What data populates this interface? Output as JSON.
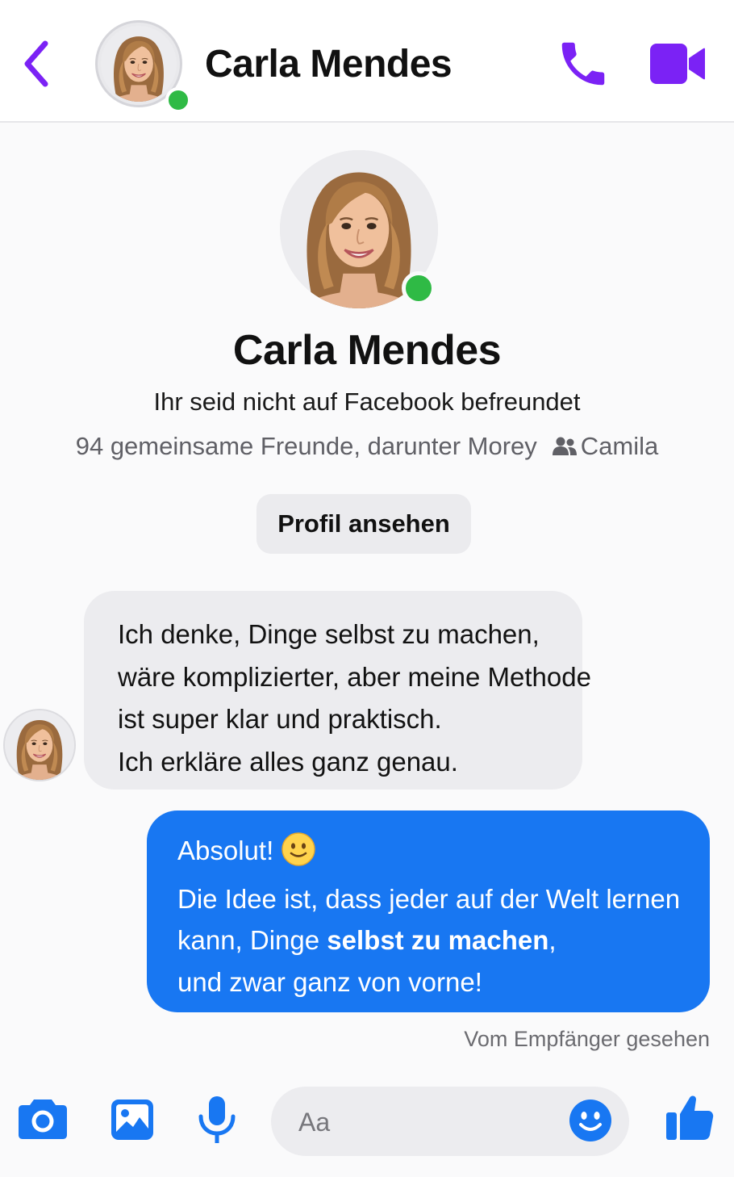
{
  "header": {
    "title": "Carla Mendes",
    "accent_color": "#7b22f5",
    "icons": [
      "back-chevron-icon",
      "phone-icon",
      "video-camera-icon"
    ]
  },
  "profile": {
    "name": "Carla Mendes",
    "friend_status": "Ihr seid nicht auf Facebook befreundet",
    "mutual_friends": "94 gemeinsame Freunde, darunter Morey",
    "mutual_name": "Camila",
    "view_profile_label": "Profil ansehen",
    "online": true,
    "online_color": "#2fba45"
  },
  "messages": [
    {
      "direction": "incoming",
      "lines": [
        "Ich denke, Dinge selbst zu machen,",
        "wäre komplizierter, aber meine Methode",
        "ist super klar und praktisch.",
        "Ich erkläre alles ganz genau."
      ]
    },
    {
      "direction": "outgoing",
      "color": "#1877f2",
      "line1": "Absolut!",
      "line2": "Die Idee ist, dass jeder auf der Welt lernen",
      "line3_pre": "kann, Dinge ",
      "line3_bold": "selbst zu machen",
      "line3_post": ",",
      "line4": "und zwar ganz von vorne!"
    }
  ],
  "seen_status": "Vom Empfänger gesehen",
  "composer": {
    "placeholder": "Aa",
    "value": "",
    "accent_color": "#1877f2",
    "icons": [
      "camera-icon",
      "gallery-icon",
      "microphone-icon",
      "emoji-icon",
      "thumbs-up-icon"
    ]
  }
}
